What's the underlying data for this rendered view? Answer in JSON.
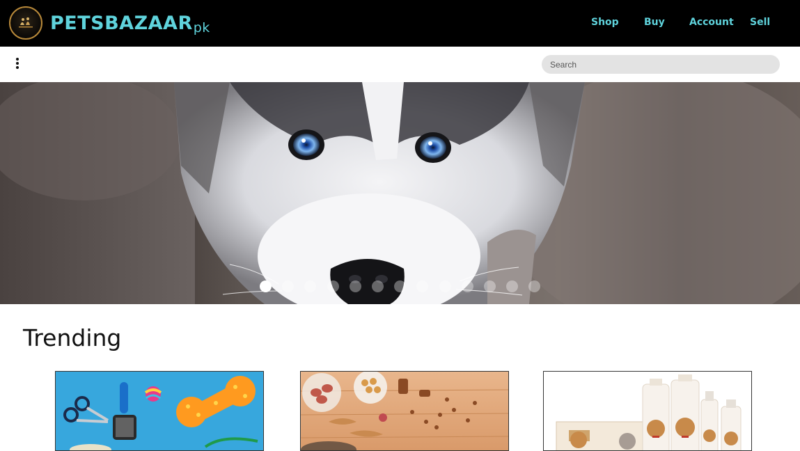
{
  "header": {
    "logo_text": "PETSBAZAAR",
    "brand_main": "PETSBAZAAR",
    "brand_suffix": "pk",
    "nav": [
      {
        "label": "Shop"
      },
      {
        "label": "Buy"
      },
      {
        "label": "Account"
      },
      {
        "label": "Sell"
      }
    ],
    "accent_color": "#5fd3dc"
  },
  "toolbar": {
    "menu_icon": "kebab-menu-icon",
    "search": {
      "placeholder": "Search",
      "value": ""
    }
  },
  "hero": {
    "image": "husky-dog-photo",
    "slide_count": 13,
    "active_slide": 1
  },
  "trending": {
    "title": "Trending",
    "cards": [
      {
        "image": "pet-grooming-tools-photo"
      },
      {
        "image": "pet-treats-photo"
      },
      {
        "image": "pet-shampoo-products-photo"
      }
    ]
  }
}
